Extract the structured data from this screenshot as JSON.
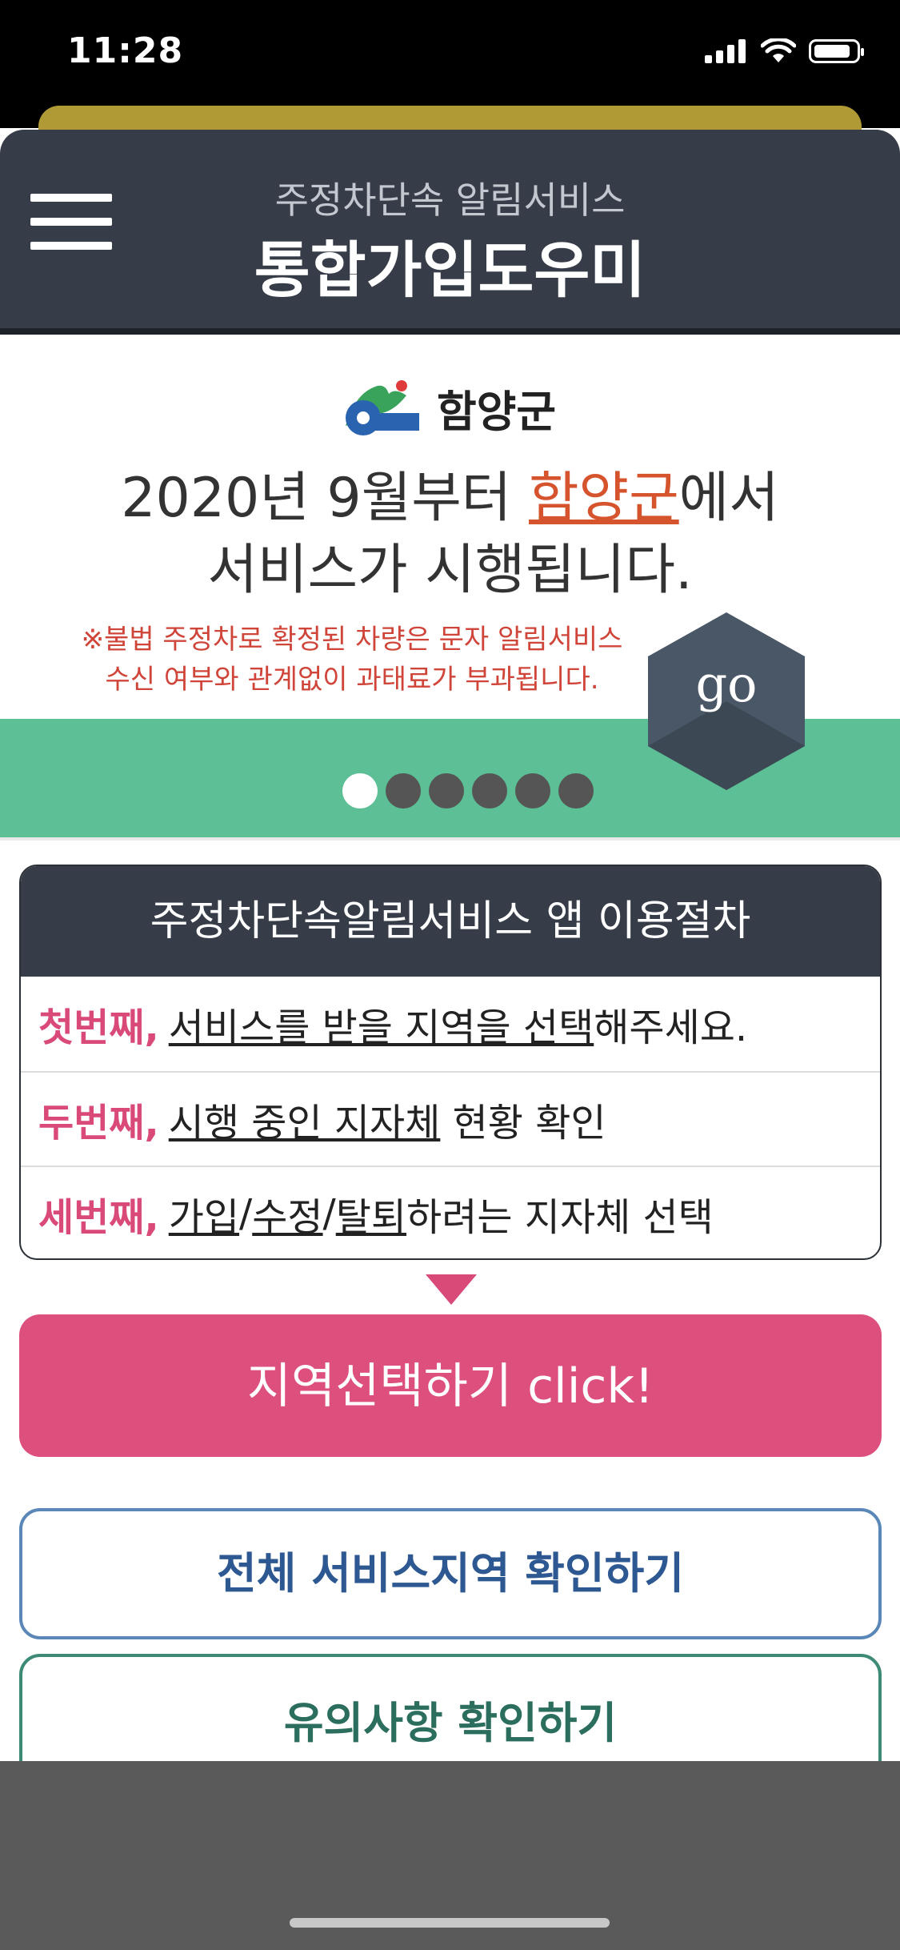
{
  "status_bar": {
    "time": "11:28"
  },
  "header": {
    "subtitle": "주정차단속 알림서비스",
    "title": "통합가입도우미"
  },
  "banner": {
    "logo_text": "함양군",
    "line1_prefix": "2020년 9월부터 ",
    "line1_highlight": "함양군",
    "line1_suffix": "에서",
    "line2": "서비스가 시행됩니다.",
    "note_line1": "※불법 주정차로 확정된 차량은 문자 알림서비스",
    "note_line2": "수신 여부와 관계없이 과태료가 부과됩니다.",
    "go_label": "go",
    "slides_total": 6,
    "slide_active": 1
  },
  "procedure": {
    "title": "주정차단속알림서비스 앱 이용절차",
    "steps": [
      {
        "ordinal": "첫번째,",
        "link": "서비스를 받을 지역을 선택",
        "rest": "해주세요."
      },
      {
        "ordinal": "두번째,",
        "link": "시행 중인 지자체",
        "rest": " 현황 확인"
      },
      {
        "ordinal": "세번째,",
        "link_parts": [
          "가입",
          "/",
          "수정",
          "/",
          "탈퇴"
        ],
        "rest": "하려는 지자체 선택"
      }
    ]
  },
  "buttons": {
    "select_region": "지역선택하기 click!",
    "check_all_regions": "전체 서비스지역 확인하기",
    "check_notes": "유의사항 확인하기"
  },
  "colors": {
    "header_bg": "#373d48",
    "accent_pink": "#dd4f7c",
    "banner_green": "#5dbf95",
    "highlight_orange": "#d6542d"
  }
}
